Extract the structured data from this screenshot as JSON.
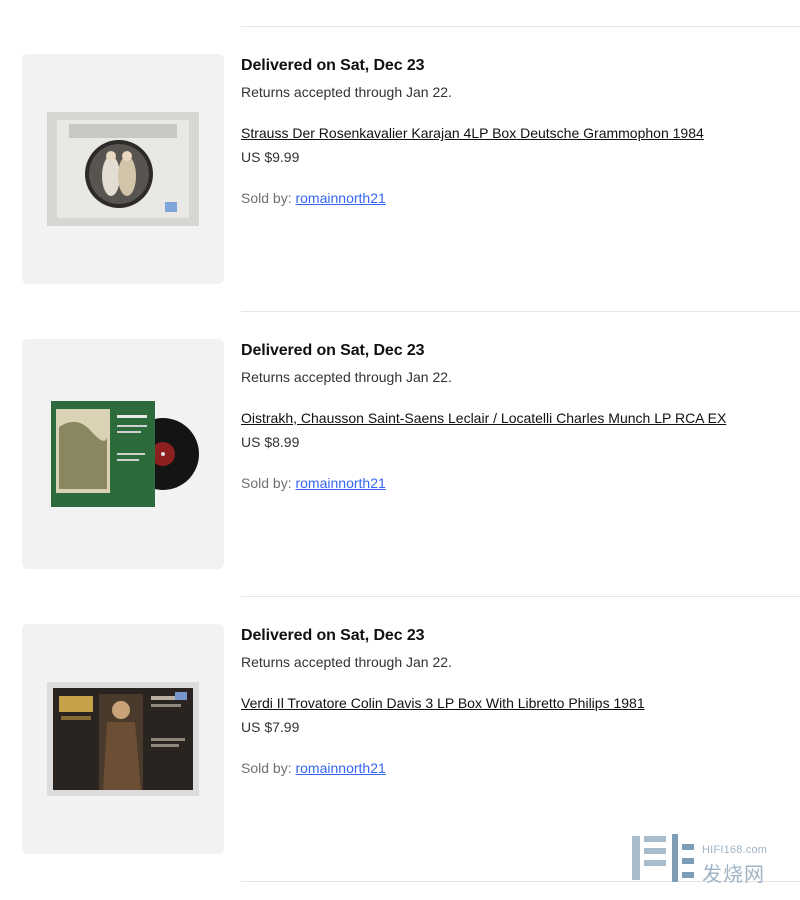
{
  "orders": [
    {
      "delivery": "Delivered on Sat, Dec 23",
      "returns": "Returns accepted through Jan 22.",
      "title": "Strauss Der Rosenkavalier Karajan 4LP Box Deutsche Grammophon 1984",
      "price": "US $9.99",
      "seller_label": "Sold by:",
      "seller_name": "romainnorth21"
    },
    {
      "delivery": "Delivered on Sat, Dec 23",
      "returns": "Returns accepted through Jan 22.",
      "title": "Oistrakh, Chausson Saint-Saens Leclair / Locatelli Charles Munch LP RCA EX",
      "price": "US $8.99",
      "seller_label": "Sold by:",
      "seller_name": "romainnorth21"
    },
    {
      "delivery": "Delivered on Sat, Dec 23",
      "returns": "Returns accepted through Jan 22.",
      "title": "Verdi Il Trovatore Colin Davis 3 LP Box With Libretto Philips 1981",
      "price": "US $7.99",
      "seller_label": "Sold by:",
      "seller_name": "romainnorth21"
    }
  ],
  "watermark": {
    "url": "HIFI168.com",
    "text": "发烧网"
  },
  "colors": {
    "link": "#3665f3",
    "divider": "#e5e5e5",
    "thumb_bg": "#f2f2f2"
  }
}
